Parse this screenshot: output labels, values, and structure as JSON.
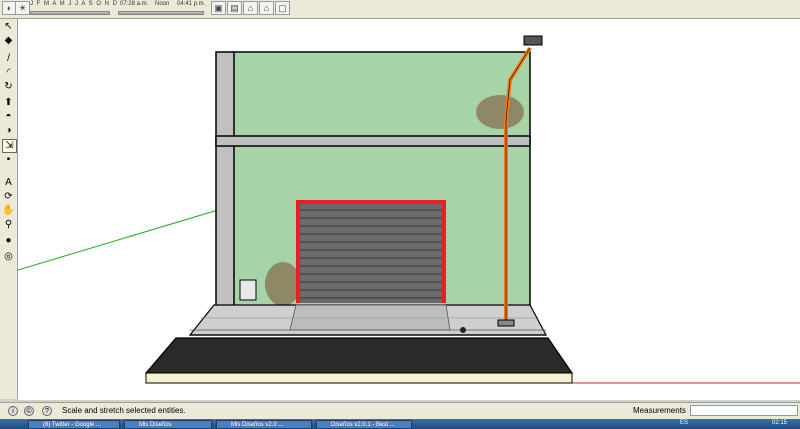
{
  "shadow_toolbar": {
    "months": "J F M A M J J A S O N D",
    "time_start": "07:28 a.m.",
    "time_label": "Noon",
    "time_end": "04:41 p.m."
  },
  "status": {
    "hint": "Scale and stretch selected entities.",
    "measurements_label": "Measurements",
    "measurements_value": ""
  },
  "taskbar": {
    "items": [
      "(8) Twitter - Google ...",
      "Mis Diseños",
      "Mis Diseños v2.0 ...",
      "Diseños v2.0.1 - Best ..."
    ],
    "lang": "ES",
    "clock": "02:15"
  },
  "tools": [
    "select",
    "eraser",
    "pencil",
    "arc",
    "rectangle-push",
    "push-pull",
    "follow-me",
    "offset",
    "scale",
    "tape",
    "dimension",
    "orbit",
    "pan",
    "zoom",
    "walk",
    "look",
    "position-camera"
  ],
  "colors": {
    "wall_fill": "#a6d4a8",
    "column_fill": "#c0c0c0",
    "door_frame": "#e82020",
    "shutter": "#6a6a6a",
    "pipe": "#f07a1c",
    "road": "#2a2a2a",
    "curb": "#f7f4d2",
    "sidewalk": "#cfcfcf"
  }
}
